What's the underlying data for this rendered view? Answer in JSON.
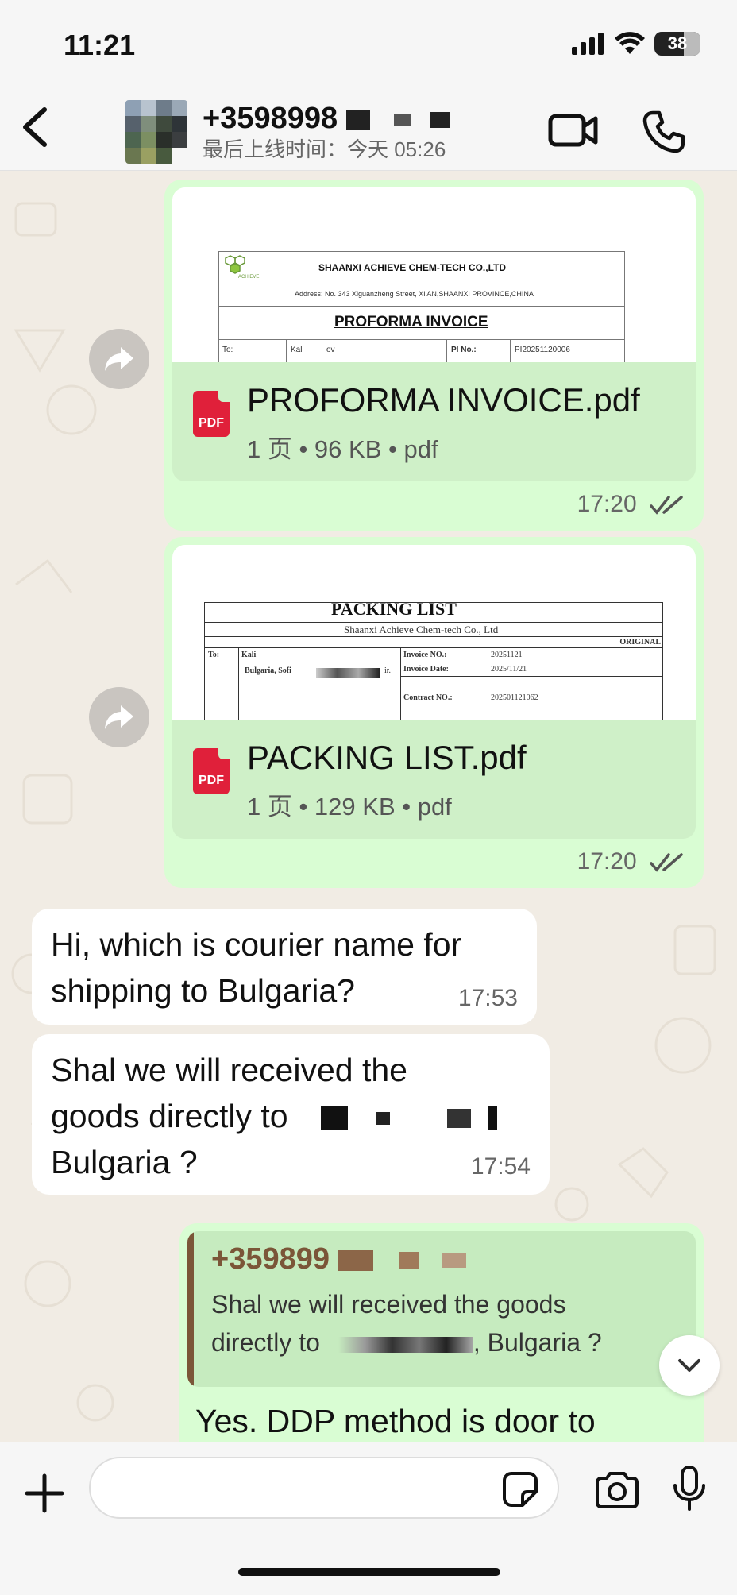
{
  "status_bar": {
    "time": "11:21",
    "battery": "38"
  },
  "header": {
    "contact_name": "+3598998",
    "contact_status": "最后上线时间：今天 05:26",
    "icons": [
      "chevron-left-icon",
      "video-camera-icon",
      "phone-icon"
    ]
  },
  "messages": [
    {
      "type": "document",
      "direction": "outgoing",
      "preview": {
        "company": "SHAANXI ACHIEVE CHEM-TECH CO.,LTD",
        "address": "Address: No. 343 Xiguanzheng Street, XI'AN,SHAANXI PROVINCE,CHINA",
        "heading": "PROFORMA INVOICE",
        "to_label": "To:",
        "to_value": "Kal",
        "to_value_end": "ov",
        "pi_label": "PI No.:",
        "pi_value": "PI20251120006"
      },
      "file_name": "PROFORMA INVOICE.pdf",
      "file_meta": "1 页 • 96 KB • pdf",
      "pdf_label": "PDF",
      "time": "17:20"
    },
    {
      "type": "document",
      "direction": "outgoing",
      "preview": {
        "heading": "PACKING LIST",
        "company": "Shaanxi Achieve Chem-tech Co., Ltd",
        "original": "ORIGINAL",
        "to_label": "To:",
        "to_value": "Kali",
        "to_value_2": "Bulgaria, Sofi",
        "to_value_3": "ir.",
        "invoice_no_label": "Invoice NO.:",
        "invoice_no": "20251121",
        "invoice_date_label": "Invoice Date:",
        "invoice_date": "2025/11/21",
        "contract_no_label": "Contract NO.:",
        "contract_no": "202501121062"
      },
      "file_name": "PACKING LIST.pdf",
      "file_meta": "1 页 • 129 KB • pdf",
      "pdf_label": "PDF",
      "time": "17:20"
    },
    {
      "type": "text",
      "direction": "incoming",
      "lines": [
        "Hi, which is  courier name for",
        "shipping to Bulgaria?"
      ],
      "time": "17:53"
    },
    {
      "type": "text",
      "direction": "incoming",
      "lines": [
        "Shal we  will received the",
        "goods directly to",
        "Bulgaria ?"
      ],
      "time": "17:54"
    },
    {
      "type": "reply",
      "direction": "outgoing",
      "quote_author": "+359899",
      "quote_lines": [
        "Shal we  will received the goods",
        "directly to",
        ", Bulgaria ?"
      ],
      "text": "Yes. DDP method is door to"
    }
  ],
  "input_bar": {
    "placeholder": ""
  },
  "colors": {
    "outgoing_bubble": "#d9fdd3",
    "incoming_bubble": "#ffffff",
    "pdf_red": "#e0203a",
    "quote_accent": "#7b5638",
    "chat_background": "#f1ece4"
  }
}
